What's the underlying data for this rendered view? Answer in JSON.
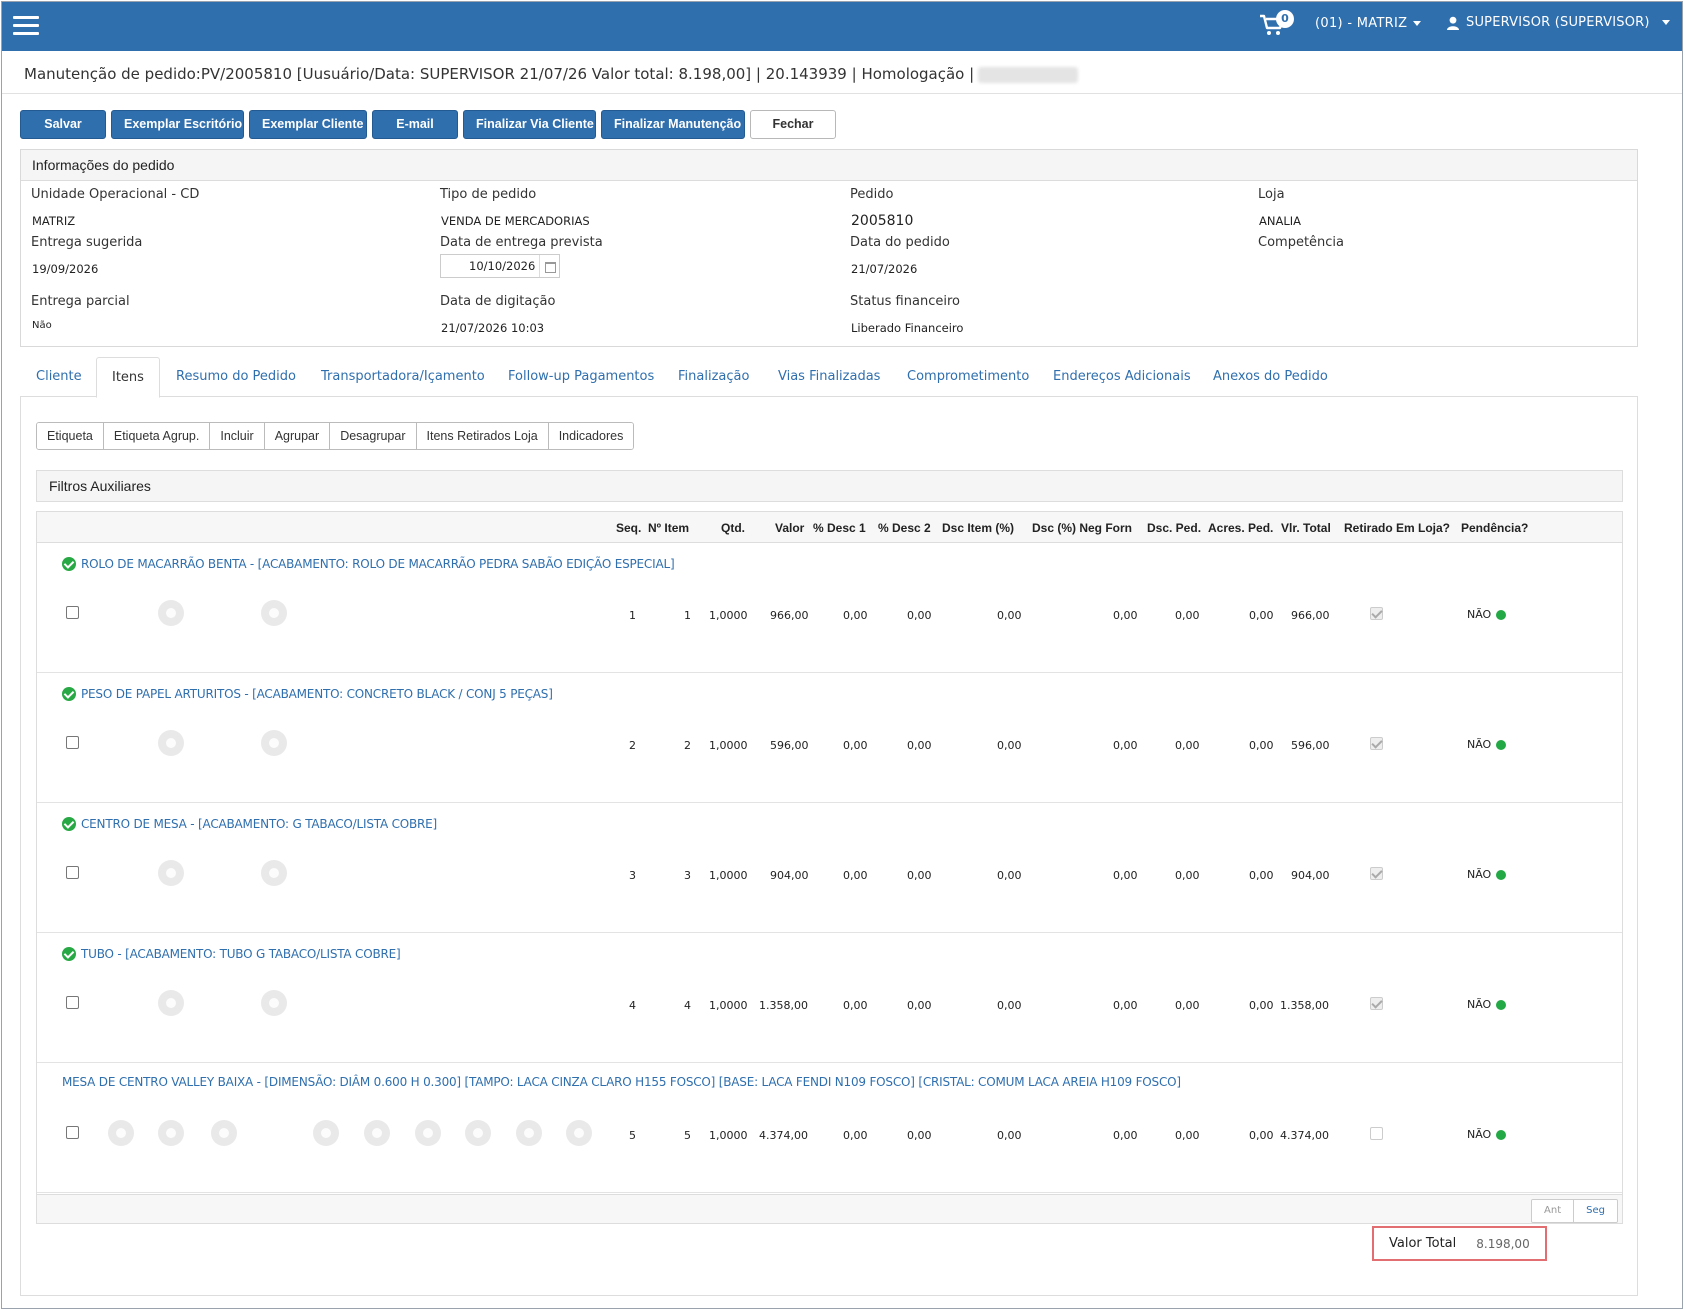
{
  "header": {
    "cart_count": "0",
    "unit": "(01) - MATRIZ",
    "user": "SUPERVISOR (SUPERVISOR)"
  },
  "page": {
    "title": "Manutenção de pedido:PV/2005810 [Uusuário/Data: SUPERVISOR 21/07/26 Valor total: 8.198,00] | 20.143939 | Homologação |"
  },
  "toolbar": {
    "salvar": "Salvar",
    "exemplar_escritorio": "Exemplar Escritório",
    "exemplar_cliente": "Exemplar Cliente",
    "email": "E-mail",
    "finalizar_via_cliente": "Finalizar Via Cliente",
    "finalizar_manutencao": "Finalizar Manutenção",
    "fechar": "Fechar"
  },
  "info": {
    "heading": "Informações do pedido",
    "unidade_label": "Unidade Operacional - CD",
    "unidade_value": "MATRIZ",
    "tipo_label": "Tipo de pedido",
    "tipo_value": "VENDA DE MERCADORIAS",
    "pedido_label": "Pedido",
    "pedido_value": "2005810",
    "loja_label": "Loja",
    "loja_value": "ANALIA",
    "entrega_sugerida_label": "Entrega sugerida",
    "entrega_sugerida_value": "19/09/2026",
    "data_entrega_label": "Data de entrega prevista",
    "data_entrega_value": "10/10/2026",
    "data_pedido_label": "Data do pedido",
    "data_pedido_value": "21/07/2026",
    "competencia_label": "Competência",
    "entrega_parcial_label": "Entrega parcial",
    "entrega_parcial_value": "Não",
    "data_digitacao_label": "Data de digitação",
    "data_digitacao_value": "21/07/2026 10:03",
    "status_label": "Status financeiro",
    "status_value": "Liberado Financeiro"
  },
  "tabs": [
    {
      "label": "Cliente"
    },
    {
      "label": "Itens"
    },
    {
      "label": "Resumo do Pedido"
    },
    {
      "label": "Transportadora/Içamento"
    },
    {
      "label": "Follow-up Pagamentos"
    },
    {
      "label": "Finalização"
    },
    {
      "label": "Vias Finalizadas"
    },
    {
      "label": "Comprometimento"
    },
    {
      "label": "Endereços Adicionais"
    },
    {
      "label": "Anexos do Pedido"
    }
  ],
  "subtools": [
    "Etiqueta",
    "Etiqueta Agrup.",
    "Incluir",
    "Agrupar",
    "Desagrupar",
    "Itens Retirados Loja",
    "Indicadores"
  ],
  "filters_label": "Filtros Auxiliares",
  "columns": {
    "seq": "Seq.",
    "item": "Nº Item",
    "qtd": "Qtd.",
    "valor": "Valor",
    "desc1": "% Desc 1",
    "desc2": "% Desc 2",
    "dsc_item": "Dsc Item (%)",
    "dsc_neg": "Dsc (%) Neg Forn",
    "dsc_ped": "Dsc. Ped.",
    "acres": "Acres. Ped.",
    "vlr_total": "Vlr. Total",
    "retirado": "Retirado Em Loja?",
    "pendencia": "Pendência?"
  },
  "items": [
    {
      "title": "ROLO DE MACARRÃO BENTA - [ACABAMENTO: ROLO DE MACARRÃO PEDRA SABÃO EDIÇÃO ESPECIAL]",
      "seq": "1",
      "item": "1",
      "qtd": "1,0000",
      "valor": "966,00",
      "desc1": "0,00",
      "desc2": "0,00",
      "dsc_item": "0,00",
      "dsc_neg": "0,00",
      "dsc_ped": "0,00",
      "acres": "0,00",
      "vlr_total": "966,00",
      "pendencia": "NÃO"
    },
    {
      "title": "PESO DE PAPEL ARTURITOS - [ACABAMENTO: CONCRETO BLACK / CONJ 5 PEÇAS]",
      "seq": "2",
      "item": "2",
      "qtd": "1,0000",
      "valor": "596,00",
      "desc1": "0,00",
      "desc2": "0,00",
      "dsc_item": "0,00",
      "dsc_neg": "0,00",
      "dsc_ped": "0,00",
      "acres": "0,00",
      "vlr_total": "596,00",
      "pendencia": "NÃO"
    },
    {
      "title": "CENTRO DE MESA - [ACABAMENTO: G TABACO/LISTA COBRE]",
      "seq": "3",
      "item": "3",
      "qtd": "1,0000",
      "valor": "904,00",
      "desc1": "0,00",
      "desc2": "0,00",
      "dsc_item": "0,00",
      "dsc_neg": "0,00",
      "dsc_ped": "0,00",
      "acres": "0,00",
      "vlr_total": "904,00",
      "pendencia": "NÃO"
    },
    {
      "title": "TUBO - [ACABAMENTO: TUBO G TABACO/LISTA COBRE]",
      "seq": "4",
      "item": "4",
      "qtd": "1,0000",
      "valor": "1.358,00",
      "desc1": "0,00",
      "desc2": "0,00",
      "dsc_item": "0,00",
      "dsc_neg": "0,00",
      "dsc_ped": "0,00",
      "acres": "0,00",
      "vlr_total": "1.358,00",
      "pendencia": "NÃO"
    },
    {
      "title": "MESA DE CENTRO VALLEY BAIXA - [DIMENSÃO: DIÂM 0.600 H 0.300] [TAMPO: LACA CINZA CLARO H155 FOSCO] [BASE: LACA FENDI N109 FOSCO] [CRISTAL: COMUM LACA AREIA H109 FOSCO]",
      "seq": "5",
      "item": "5",
      "qtd": "1,0000",
      "valor": "4.374,00",
      "desc1": "0,00",
      "desc2": "0,00",
      "dsc_item": "0,00",
      "dsc_neg": "0,00",
      "dsc_ped": "0,00",
      "acres": "0,00",
      "vlr_total": "4.374,00",
      "pendencia": "NÃO"
    }
  ],
  "pager": {
    "prev": "Ant",
    "next": "Seg"
  },
  "total": {
    "label": "Valor Total",
    "value": "8.198,00"
  }
}
